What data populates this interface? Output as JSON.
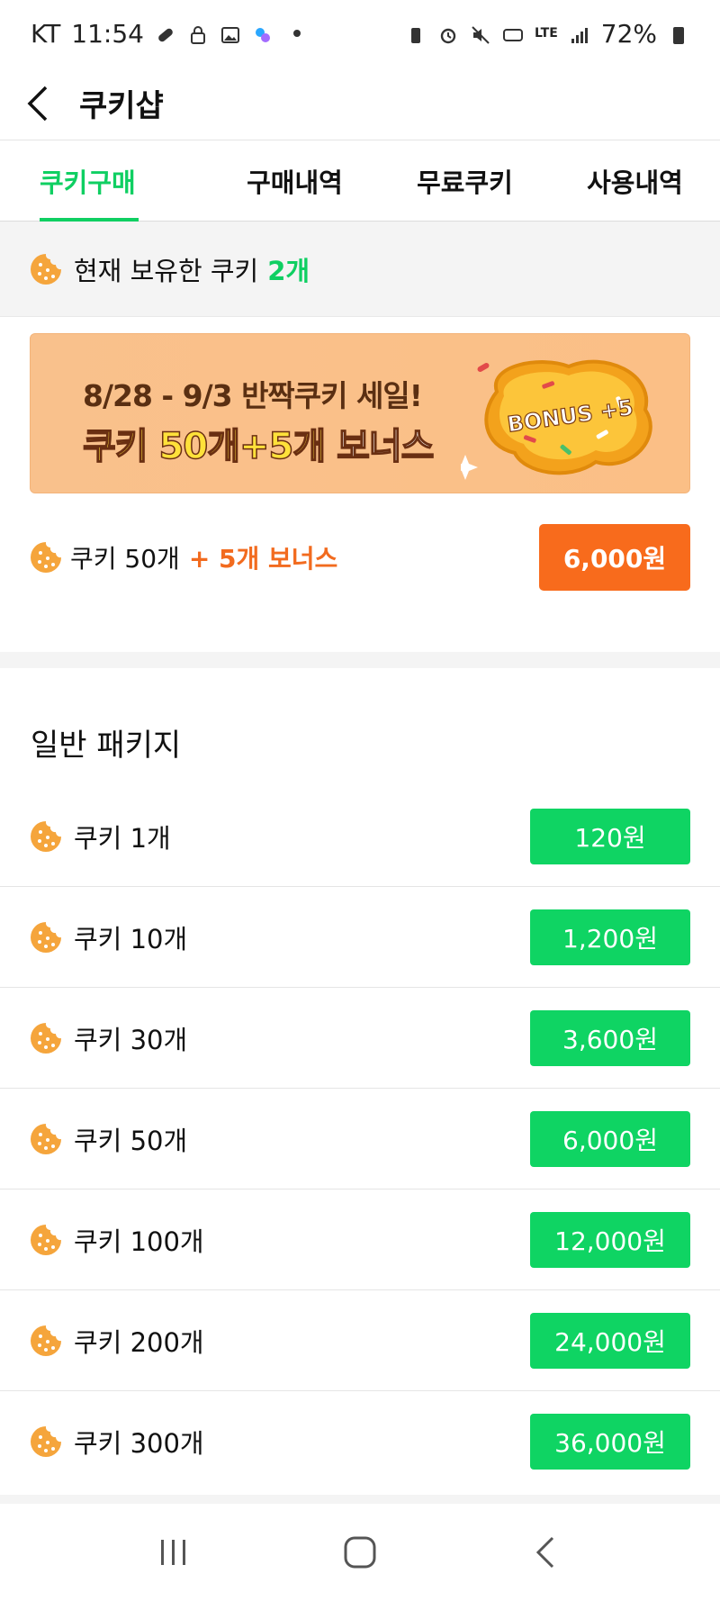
{
  "status_bar": {
    "carrier": "KT",
    "time": "11:54",
    "network": "LTE",
    "battery": "72%"
  },
  "header": {
    "title": "쿠키샵"
  },
  "tabs": [
    {
      "label": "쿠키구매",
      "active": true
    },
    {
      "label": "구매내역",
      "active": false
    },
    {
      "label": "무료쿠키",
      "active": false
    },
    {
      "label": "사용내역",
      "active": false
    }
  ],
  "balance": {
    "label": "현재 보유한 쿠키",
    "count": "2개"
  },
  "banner": {
    "line1": "8/28 - 9/3 반짝쿠키 세일!",
    "line2_part1": "쿠키 50개+5개",
    "line2_part2": "보너스",
    "badge": "BONUS +5"
  },
  "promo": {
    "name": "쿠키 50개",
    "bonus": "+ 5개 보너스",
    "price": "6,000원"
  },
  "section_title": "일반 패키지",
  "packages": [
    {
      "name": "쿠키 1개",
      "price": "120원"
    },
    {
      "name": "쿠키 10개",
      "price": "1,200원"
    },
    {
      "name": "쿠키 30개",
      "price": "3,600원"
    },
    {
      "name": "쿠키 50개",
      "price": "6,000원"
    },
    {
      "name": "쿠키 100개",
      "price": "12,000원"
    },
    {
      "name": "쿠키 200개",
      "price": "24,000원"
    },
    {
      "name": "쿠키 300개",
      "price": "36,000원"
    }
  ],
  "colors": {
    "accent_green": "#0fcf62",
    "promo_orange": "#f86b1c",
    "cookie": "#f5a53c"
  }
}
